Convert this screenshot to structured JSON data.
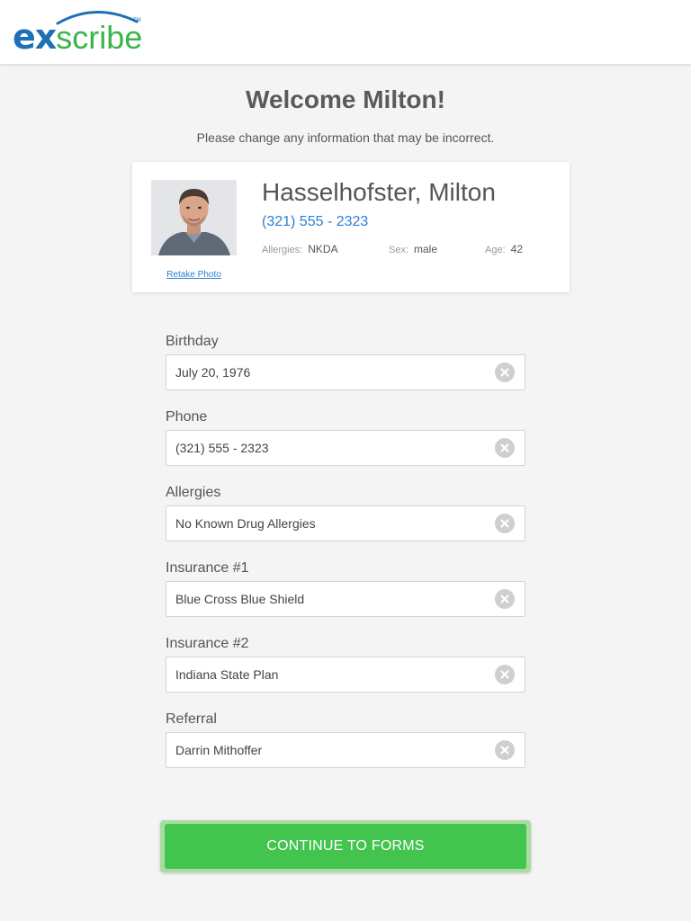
{
  "brand": {
    "ex": "ex",
    "scribe": "scribe",
    "tm": "TM"
  },
  "welcome": "Welcome Milton!",
  "subtitle": "Please change any information that may be incorrect.",
  "patient": {
    "name": "Hasselhofster, Milton",
    "phone": "(321) 555 - 2323",
    "allergies_label": "Allergies:",
    "allergies_value": "NKDA",
    "sex_label": "Sex:",
    "sex_value": "male",
    "age_label": "Age:",
    "age_value": "42",
    "retake_label": "Retake Photo"
  },
  "fields": [
    {
      "label": "Birthday",
      "value": "July 20, 1976"
    },
    {
      "label": "Phone",
      "value": "(321) 555 - 2323"
    },
    {
      "label": "Allergies",
      "value": "No Known Drug Allergies"
    },
    {
      "label": "Insurance #1",
      "value": "Blue Cross Blue Shield"
    },
    {
      "label": "Insurance #2",
      "value": "Indiana State Plan"
    },
    {
      "label": "Referral",
      "value": "Darrin Mithoffer"
    }
  ],
  "cta_label": "CONTINUE TO FORMS",
  "colors": {
    "brand_blue": "#1f6fb7",
    "brand_green": "#39b54a",
    "link_blue": "#2b7fd4",
    "cta_green": "#43c44f"
  }
}
